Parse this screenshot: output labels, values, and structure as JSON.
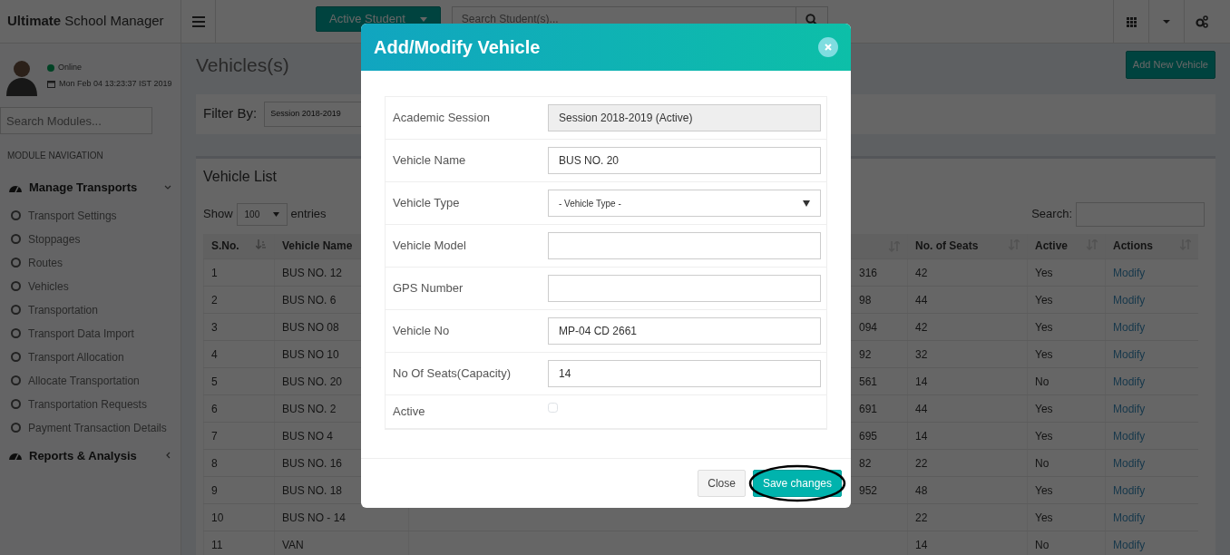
{
  "topbar": {
    "brand": "**Ultimate** School Manager",
    "student_button": "Active Student",
    "search": {
      "placeholder": "Search Student(s)..."
    }
  },
  "sidebar": {
    "status": "Online",
    "datetime": "Mon Feb 04 13:23:37 IST 2019",
    "search": {
      "placeholder": "Search Modules..."
    },
    "header": "MODULE NAVIGATION",
    "menus": [
      {
        "label": "Manage Transports",
        "expanded": true,
        "children": [
          {
            "label": "Transport Settings"
          },
          {
            "label": "Stoppages"
          },
          {
            "label": "Routes"
          },
          {
            "label": "Vehicles"
          },
          {
            "label": "Transportation"
          },
          {
            "label": "Transport Data Import"
          },
          {
            "label": "Transport Allocation"
          },
          {
            "label": "Allocate Transportation"
          },
          {
            "label": "Transportation Requests"
          },
          {
            "label": "Payment Transaction Details"
          }
        ]
      },
      {
        "label": "Reports & Analysis",
        "expanded": false
      }
    ]
  },
  "page_title": "Vehicles(s)",
  "add_button": "Add New Vehicle",
  "filter": {
    "label": "Filter By:",
    "value": "Session 2018-2019"
  },
  "vehicle_list": {
    "title": "Vehicle List",
    "show_label": "Show",
    "page_size": "100",
    "entries_label": "entries",
    "search_label": "Search:",
    "columns": [
      {
        "label": "S.No.",
        "sorted": true
      },
      {
        "label": "Vehicle Name"
      },
      {
        "sorted": false
      },
      {
        "label": "No. of Seats",
        "sorted": false
      },
      {
        "label": "Active",
        "sorted": false
      },
      {
        "label": "Actions",
        "sorted": false
      }
    ],
    "rows": [
      {
        "sno": "1",
        "name": "BUS NO. 12",
        "column_6": "316",
        "seats": "42",
        "active": "Yes",
        "action": "Modify"
      },
      {
        "sno": "2",
        "name": "BUS NO. 6",
        "column_6": "98",
        "seats": "44",
        "active": "Yes",
        "action": "Modify"
      },
      {
        "sno": "3",
        "name": "BUS NO 08",
        "column_6": "094",
        "seats": "42",
        "active": "Yes",
        "action": "Modify"
      },
      {
        "sno": "4",
        "name": "BUS NO 10",
        "column_6": "92",
        "seats": "32",
        "active": "Yes",
        "action": "Modify"
      },
      {
        "sno": "5",
        "name": "BUS NO. 20",
        "column_6": "561",
        "seats": "14",
        "active": "No",
        "action": "Modify"
      },
      {
        "sno": "6",
        "name": "BUS NO. 2",
        "column_6": "691",
        "seats": "44",
        "active": "Yes",
        "action": "Modify"
      },
      {
        "sno": "7",
        "name": "BUS NO 4",
        "column_6": "695",
        "seats": "14",
        "active": "Yes",
        "action": "Modify"
      },
      {
        "sno": "8",
        "name": "BUS NO. 16",
        "column_6": "82",
        "seats": "22",
        "active": "No",
        "action": "Modify"
      },
      {
        "sno": "9",
        "name": "BUS NO. 18",
        "column_6": "952",
        "seats": "48",
        "active": "Yes",
        "action": "Modify"
      },
      {
        "sno": "10",
        "name": "BUS NO - 14",
        "seats": "22",
        "active": "Yes",
        "action": "Modify"
      },
      {
        "sno": "11",
        "name": "VAN",
        "seats": "14",
        "active": "No",
        "action": "Modify"
      }
    ]
  },
  "modal": {
    "title": "Add/Modify Vehicle",
    "fields": [
      {
        "label": "Academic Session",
        "kind": "readonly",
        "value": "Session 2018-2019 (Active)"
      },
      {
        "label": "Vehicle Name",
        "kind": "text",
        "value": "BUS NO. 20"
      },
      {
        "label": "Vehicle Type",
        "kind": "select",
        "value": "- Vehicle Type -"
      },
      {
        "label": "Vehicle Model",
        "kind": "text"
      },
      {
        "label": "GPS Number",
        "kind": "text"
      },
      {
        "label": "Vehicle No",
        "kind": "text",
        "value": "MP-04 CD 2661"
      },
      {
        "label": "No Of Seats(Capacity)",
        "kind": "text",
        "value": "14"
      },
      {
        "label": "Active",
        "kind": "checkbox",
        "checked": false
      }
    ],
    "buttons": [
      {
        "label": "Close",
        "kind": "default",
        "circled": false
      },
      {
        "label": "Save changes",
        "kind": "primary",
        "circled": true
      }
    ]
  }
}
